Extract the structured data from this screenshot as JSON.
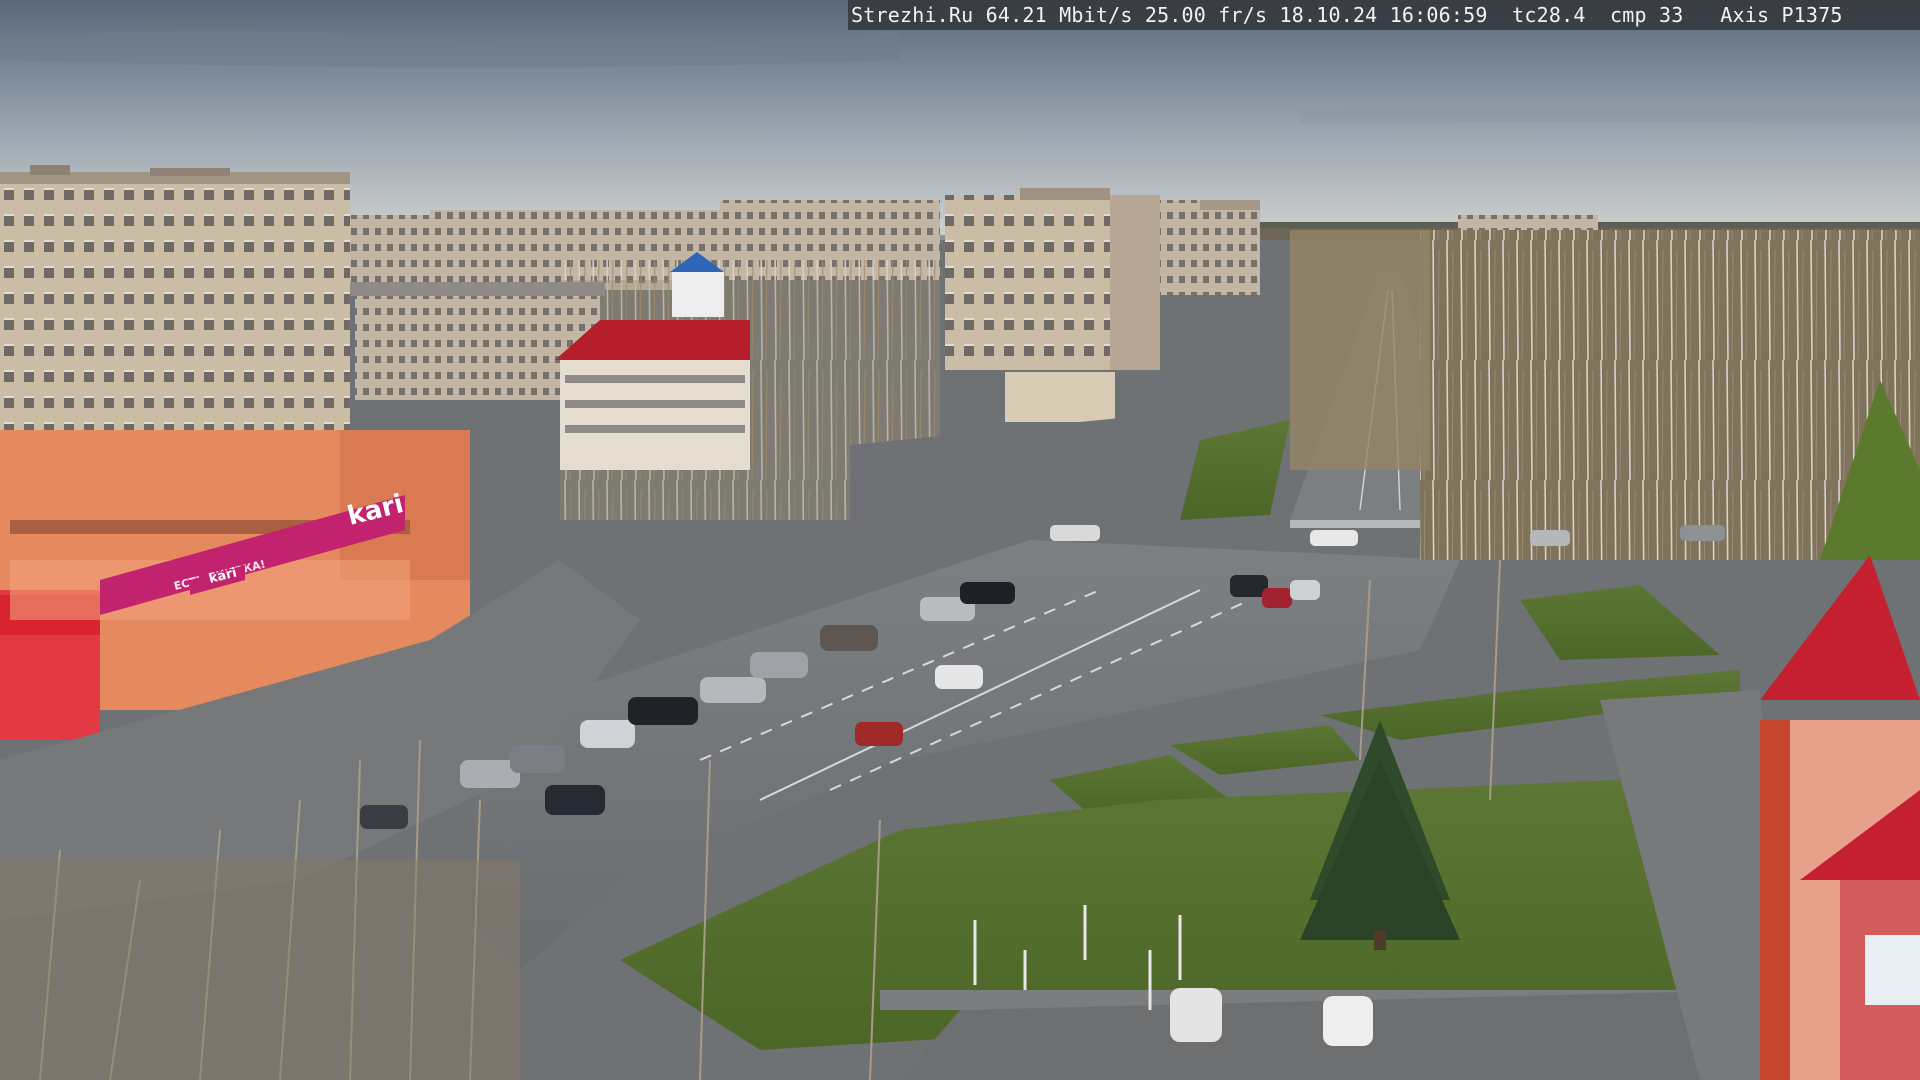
{
  "overlay": {
    "site": "Strezhi.Ru",
    "bitrate": "64.21 Mbit/s",
    "framerate": "25.00 fr/s",
    "date": "18.10.24",
    "time": "16:06:59",
    "tc": "tc28.4",
    "cmp": "cmp 33",
    "camera": "Axis P1375"
  },
  "signs": {
    "store_logo": "kari",
    "store_logo_small": "kari",
    "store_slogan": "ЕСТЬ СКИДКА!"
  },
  "colors": {
    "sky_top": "#5d6b7a",
    "sky_horizon": "#c7cbce",
    "building_beige": "#c9b9a2",
    "store_orange": "#e9875a",
    "store_magenta": "#c2236e",
    "roof_red": "#c42030",
    "asphalt": "#75787b",
    "grass": "#56712f"
  }
}
